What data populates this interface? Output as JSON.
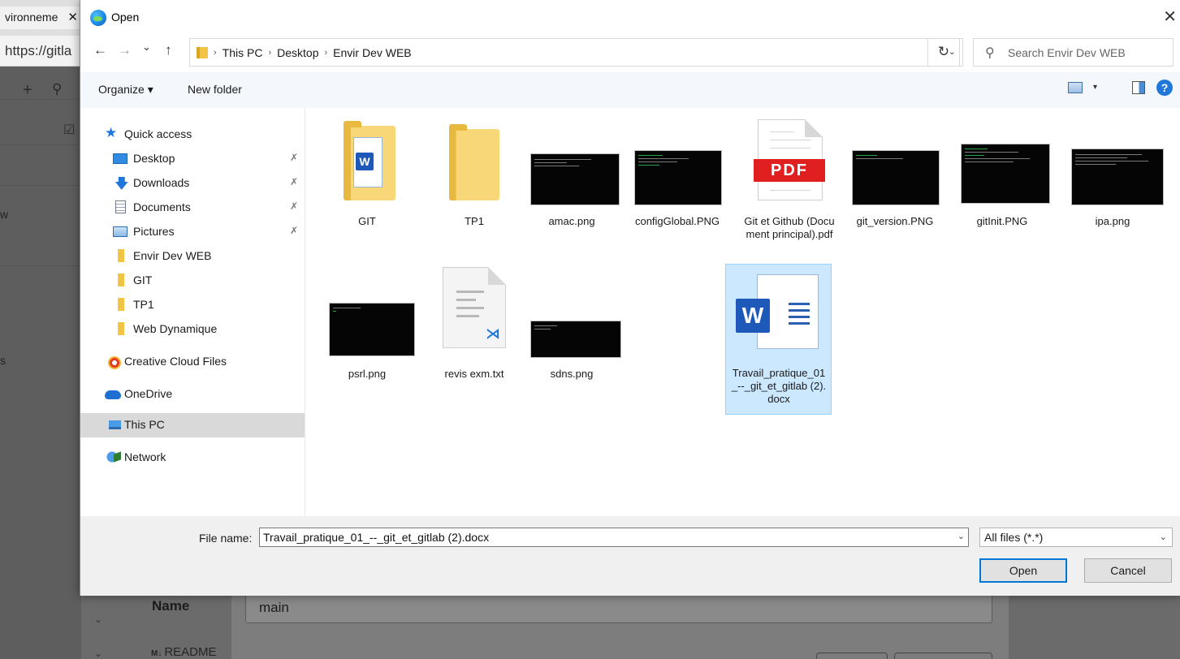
{
  "background": {
    "tab_label": "vironneme",
    "tab_close": "✕",
    "url_text": "https://gitla",
    "side_letters": [
      "w",
      "s"
    ],
    "name_header": "Name",
    "readme_label": "README",
    "readme_icon": "M↓",
    "branch_value": "main",
    "chevron": "⌄"
  },
  "dialog": {
    "title": "Open",
    "close_icon": "✕",
    "nav": {
      "back": "←",
      "forward": "→",
      "recent": "⌄",
      "up": "↑",
      "breadcrumb": [
        "This PC",
        "Desktop",
        "Envir Dev WEB"
      ],
      "separator": "›",
      "dropdown": "⌄",
      "refresh": "↻",
      "search_placeholder": "Search Envir Dev WEB",
      "search_icon": "⚲"
    },
    "toolbar": {
      "organize": "Organize ▾",
      "new_folder": "New folder",
      "view_dropdown": "▾",
      "help": "?"
    },
    "nav_pane": [
      {
        "label": "Quick access",
        "icon": "star-icon",
        "glyph": "★"
      },
      {
        "label": "Desktop",
        "icon": "desktop-icon",
        "pinned": true
      },
      {
        "label": "Downloads",
        "icon": "downloads-icon",
        "glyph": "🡇",
        "pinned": true
      },
      {
        "label": "Documents",
        "icon": "documents-icon",
        "pinned": true
      },
      {
        "label": "Pictures",
        "icon": "pictures-icon",
        "pinned": true
      },
      {
        "label": "Envir Dev WEB",
        "icon": "folder-icon"
      },
      {
        "label": "GIT",
        "icon": "folder-icon"
      },
      {
        "label": "TP1",
        "icon": "folder-icon"
      },
      {
        "label": "Web Dynamique",
        "icon": "folder-icon"
      },
      {
        "label": "Creative Cloud Files",
        "icon": "creative-cloud-icon"
      },
      {
        "label": "OneDrive",
        "icon": "onedrive-icon"
      },
      {
        "label": "This PC",
        "icon": "this-pc-icon",
        "selected": true
      },
      {
        "label": "Network",
        "icon": "network-icon"
      }
    ],
    "pin_glyph": "✗",
    "files": [
      {
        "name": "GIT",
        "kind": "folder-doc"
      },
      {
        "name": "TP1",
        "kind": "folder"
      },
      {
        "name": "amac.png",
        "kind": "image"
      },
      {
        "name": "configGlobal.PNG",
        "kind": "image"
      },
      {
        "name": "Git et Github (Document principal).pdf",
        "kind": "pdf",
        "badge": "PDF"
      },
      {
        "name": "git_version.PNG",
        "kind": "image"
      },
      {
        "name": "gitInit.PNG",
        "kind": "image"
      },
      {
        "name": "ipa.png",
        "kind": "image"
      },
      {
        "name": "psrl.png",
        "kind": "image"
      },
      {
        "name": "revis exm.txt",
        "kind": "text"
      },
      {
        "name": "sdns.png",
        "kind": "image"
      },
      {
        "name": "Travail_pratique_01_--_git_et_gitlab (2).docx",
        "kind": "word",
        "selected": true,
        "badge": "W"
      }
    ],
    "footer": {
      "file_name_label": "File name:",
      "file_name_value": "Travail_pratique_01_--_git_et_gitlab (2).docx",
      "file_type": "All files (*.*)",
      "dropdown": "⌄",
      "open": "Open",
      "cancel": "Cancel"
    }
  },
  "colors": {
    "accent": "#0078d7",
    "selection": "#cce8ff",
    "selection_border": "#99d1ff",
    "toolbar_bg": "#f4f7fc",
    "footer_bg": "#f0f0f0"
  }
}
